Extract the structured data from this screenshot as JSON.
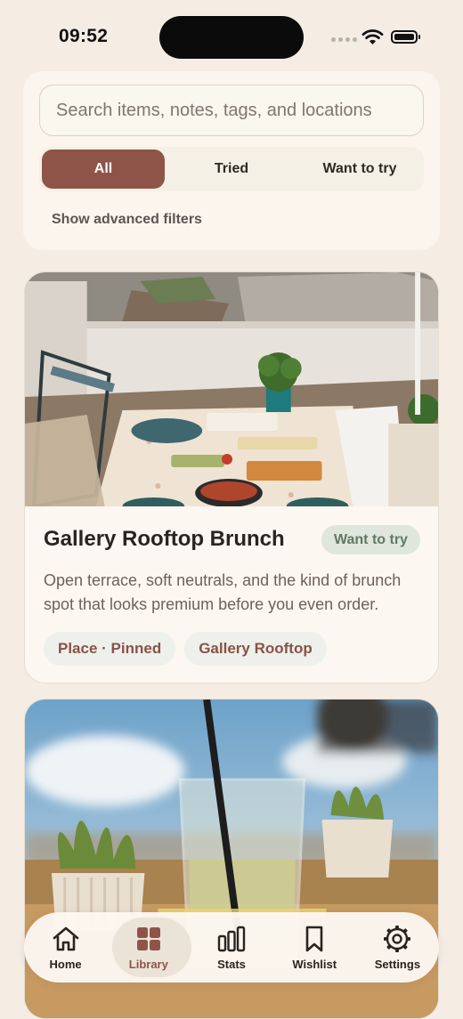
{
  "status_bar": {
    "time": "09:52"
  },
  "search": {
    "placeholder": "Search items, notes, tags, and locations",
    "value": ""
  },
  "filters": {
    "segments": [
      "All",
      "Tried",
      "Want to try"
    ],
    "selected": "All",
    "advanced_label": "Show advanced filters"
  },
  "cards": [
    {
      "title": "Gallery Rooftop Brunch",
      "status": "Want to try",
      "description": "Open terrace, soft neutrals, and the kind of brunch spot that looks premium before you even order.",
      "tags": [
        "Place · Pinned",
        "Gallery Rooftop"
      ],
      "photo": "rooftop-brunch-table-photo"
    },
    {
      "photo": "iced-drink-with-succulents-photo"
    }
  ],
  "bottom_nav": {
    "items": [
      {
        "label": "Home",
        "icon": "home-icon"
      },
      {
        "label": "Library",
        "icon": "grid-icon"
      },
      {
        "label": "Stats",
        "icon": "bar-chart-icon"
      },
      {
        "label": "Wishlist",
        "icon": "bookmark-icon"
      },
      {
        "label": "Settings",
        "icon": "gear-icon"
      }
    ],
    "active": "Library"
  },
  "colors": {
    "background": "#f5ede4",
    "accent": "#8f5448",
    "status_badge_bg": "#dfe6dc",
    "status_badge_text": "#5f7a63",
    "tag_text": "#8a5244"
  }
}
